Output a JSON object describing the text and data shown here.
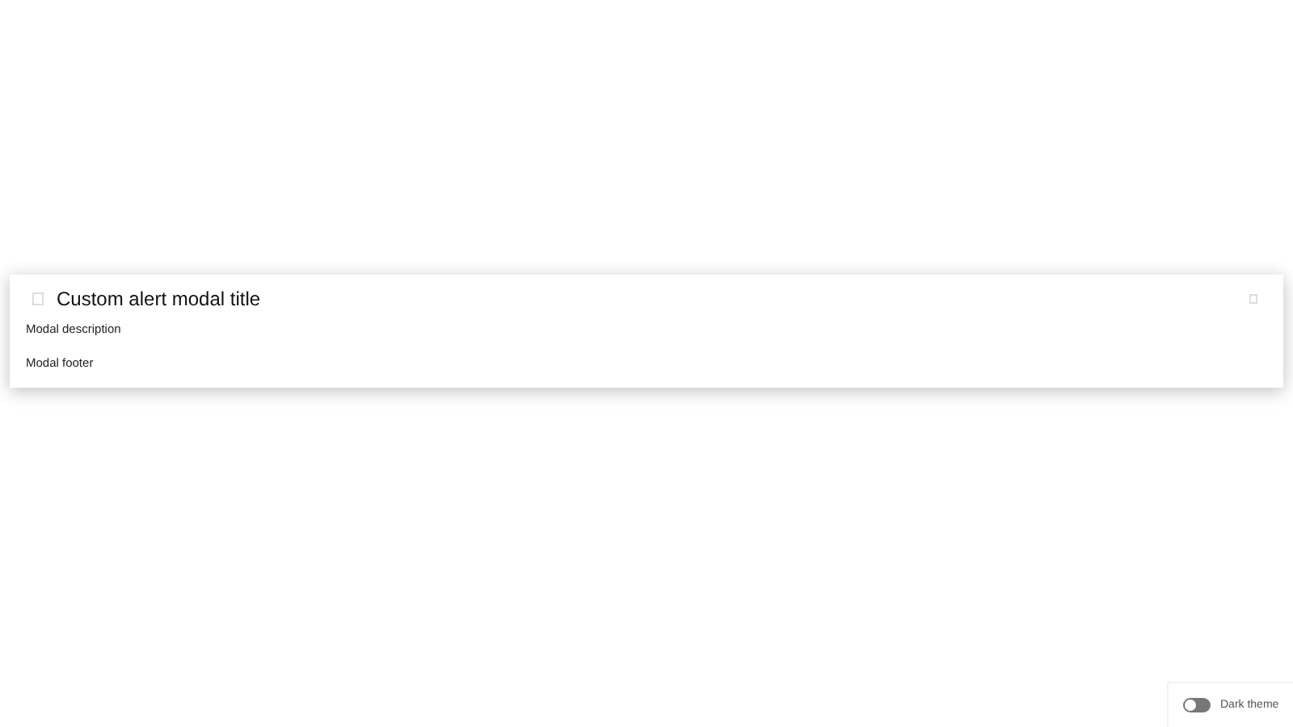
{
  "modal": {
    "title": "Custom alert modal title",
    "description": "Modal description",
    "footer": "Modal footer"
  },
  "theme_toggle": {
    "label": "Dark theme",
    "on": false
  }
}
